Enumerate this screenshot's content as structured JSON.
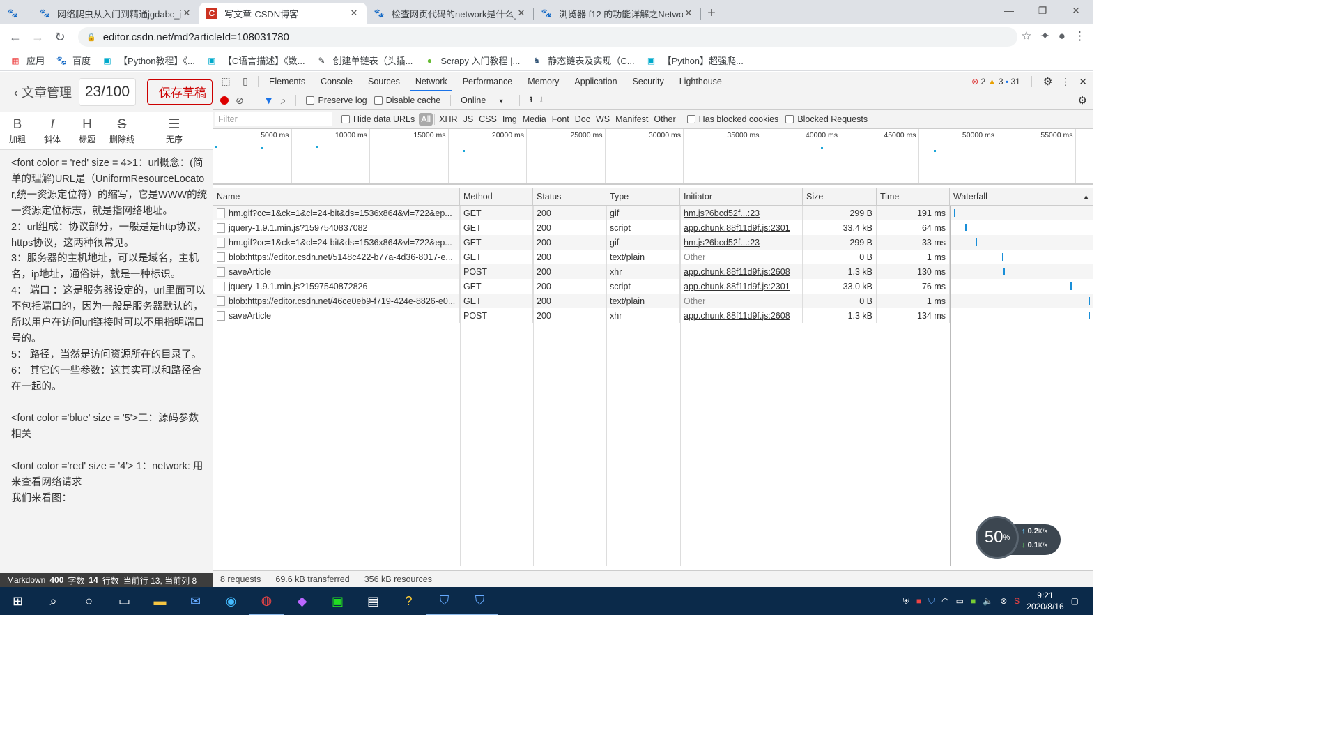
{
  "browser": {
    "tabs": [
      {
        "label": "网络爬虫从入门到精通jgdabc_百",
        "icon": "baidu-paw-icon",
        "active": false
      },
      {
        "label": "写文章-CSDN博客",
        "icon": "csdn-icon",
        "active": true
      },
      {
        "label": "检查网页代码的network是什么_",
        "icon": "baidu-paw-icon",
        "active": false
      },
      {
        "label": "浏览器 f12 的功能详解之Networ",
        "icon": "baidu-paw-icon",
        "active": false
      }
    ],
    "url": "editor.csdn.net/md?articleId=108031780",
    "bookmarks": [
      {
        "label": "应用",
        "icon": "apps-grid-icon"
      },
      {
        "label": "百度",
        "icon": "baidu-paw-icon"
      },
      {
        "label": "【Python教程】《...",
        "icon": "bilibili-icon"
      },
      {
        "label": "【C语言描述】《数...",
        "icon": "bilibili-icon"
      },
      {
        "label": "创建单链表（头插...",
        "icon": "bookmark-icon"
      },
      {
        "label": "Scrapy 入门教程 |...",
        "icon": "runoob-icon"
      },
      {
        "label": "静态链表及实现（C...",
        "icon": "bookmark-icon"
      },
      {
        "label": "【Python】超强爬...",
        "icon": "bilibili-icon"
      }
    ]
  },
  "editor": {
    "back_label": "文章管理",
    "title_count": "23/100",
    "save_label": "保存草稿",
    "tools": [
      {
        "glyph": "B",
        "label": "加粗"
      },
      {
        "glyph": "I",
        "label": "斜体"
      },
      {
        "glyph": "H",
        "label": "标题"
      },
      {
        "glyph": "S",
        "label": "删除线"
      },
      {
        "glyph": "☰",
        "label": "无序"
      }
    ],
    "lines": [
      "<font color = 'red' size = 4>1：url概念：(简单的理解)URL是（UniformResourceLocator,统一资源定位符）的缩写，它是WWW的统一资源定位标志，就是指网络地址。",
      "2：url组成：协议部分，一般是是http协议，https协议，这两种很常见。",
      "3：服务器的主机地址，可以是域名，主机名，ip地址，通俗讲，就是一种标识。",
      "4： 端口 ：这是服务器设定的，url里面可以不包括端口的，因为一般是服务器默认的，所以用户在访问url链接时可以不用指明端口号的。",
      "5： 路径，当然是访问资源所在的目录了。",
      "6： 其它的一些参数：这其实可以和路径合在一起的。",
      "",
      "<font color ='blue' size = '5'>二：源码参数相关",
      "",
      "<font color ='red' size = '4'> 1：network: 用来查看网络请求",
      "我们来看图："
    ],
    "status": {
      "mode": "Markdown",
      "words": "400",
      "words_label": "字数",
      "lines": "14",
      "lines_label": "行数",
      "cursor": "当前行 13, 当前列 8"
    }
  },
  "devtools": {
    "tabs": [
      "Elements",
      "Console",
      "Sources",
      "Network",
      "Performance",
      "Memory",
      "Application",
      "Security",
      "Lighthouse"
    ],
    "active_tab": "Network",
    "errors": "2",
    "warnings": "3",
    "messages": "31",
    "toolbar": {
      "preserve_log": "Preserve log",
      "disable_cache": "Disable cache",
      "throttle": "Online"
    },
    "filter": {
      "placeholder": "Filter",
      "hide_data_urls": "Hide data URLs",
      "types": [
        "All",
        "XHR",
        "JS",
        "CSS",
        "Img",
        "Media",
        "Font",
        "Doc",
        "WS",
        "Manifest",
        "Other"
      ],
      "blocked_cookies": "Has blocked cookies",
      "blocked_requests": "Blocked Requests"
    },
    "overview_ticks": [
      "5000 ms",
      "10000 ms",
      "15000 ms",
      "20000 ms",
      "25000 ms",
      "30000 ms",
      "35000 ms",
      "40000 ms",
      "45000 ms",
      "50000 ms",
      "55000 ms"
    ],
    "columns": [
      "Name",
      "Method",
      "Status",
      "Type",
      "Initiator",
      "Size",
      "Time",
      "Waterfall"
    ],
    "rows": [
      {
        "name": "hm.gif?cc=1&ck=1&cl=24-bit&ds=1536x864&vl=722&ep...",
        "method": "GET",
        "status": "200",
        "type": "gif",
        "initiator": "hm.js?6bcd52f...:23",
        "initiator_link": true,
        "size": "299 B",
        "time": "191 ms",
        "wf_start": 0.01
      },
      {
        "name": "jquery-1.9.1.min.js?1597540837082",
        "method": "GET",
        "status": "200",
        "type": "script",
        "initiator": "app.chunk.88f11d9f.js:2301",
        "initiator_link": true,
        "size": "33.4 kB",
        "time": "64 ms",
        "wf_start": 0.09
      },
      {
        "name": "hm.gif?cc=1&ck=1&cl=24-bit&ds=1536x864&vl=722&ep...",
        "method": "GET",
        "status": "200",
        "type": "gif",
        "initiator": "hm.js?6bcd52f...:23",
        "initiator_link": true,
        "size": "299 B",
        "time": "33 ms",
        "wf_start": 0.17
      },
      {
        "name": "blob:https://editor.csdn.net/5148c422-b77a-4d36-8017-e...",
        "method": "GET",
        "status": "200",
        "type": "text/plain",
        "initiator": "Other",
        "initiator_link": false,
        "size": "0 B",
        "time": "1 ms",
        "wf_start": 0.36
      },
      {
        "name": "saveArticle",
        "method": "POST",
        "status": "200",
        "type": "xhr",
        "initiator": "app.chunk.88f11d9f.js:2608",
        "initiator_link": true,
        "size": "1.3 kB",
        "time": "130 ms",
        "wf_start": 0.37
      },
      {
        "name": "jquery-1.9.1.min.js?1597540872826",
        "method": "GET",
        "status": "200",
        "type": "script",
        "initiator": "app.chunk.88f11d9f.js:2301",
        "initiator_link": true,
        "size": "33.0 kB",
        "time": "76 ms",
        "wf_start": 0.86
      },
      {
        "name": "blob:https://editor.csdn.net/46ce0eb9-f719-424e-8826-e0...",
        "method": "GET",
        "status": "200",
        "type": "text/plain",
        "initiator": "Other",
        "initiator_link": false,
        "size": "0 B",
        "time": "1 ms",
        "wf_start": 0.995
      },
      {
        "name": "saveArticle",
        "method": "POST",
        "status": "200",
        "type": "xhr",
        "initiator": "app.chunk.88f11d9f.js:2608",
        "initiator_link": true,
        "size": "1.3 kB",
        "time": "134 ms",
        "wf_start": 0.995
      }
    ],
    "summary": {
      "requests": "8 requests",
      "transferred": "69.6 kB transferred",
      "resources": "356 kB resources"
    }
  },
  "net_widget": {
    "percent": "50",
    "unit": "%",
    "up": "0.2",
    "down": "0.1",
    "rate_unit": "K/s"
  },
  "taskbar": {
    "time": "9:21",
    "date": "2020/8/16"
  }
}
